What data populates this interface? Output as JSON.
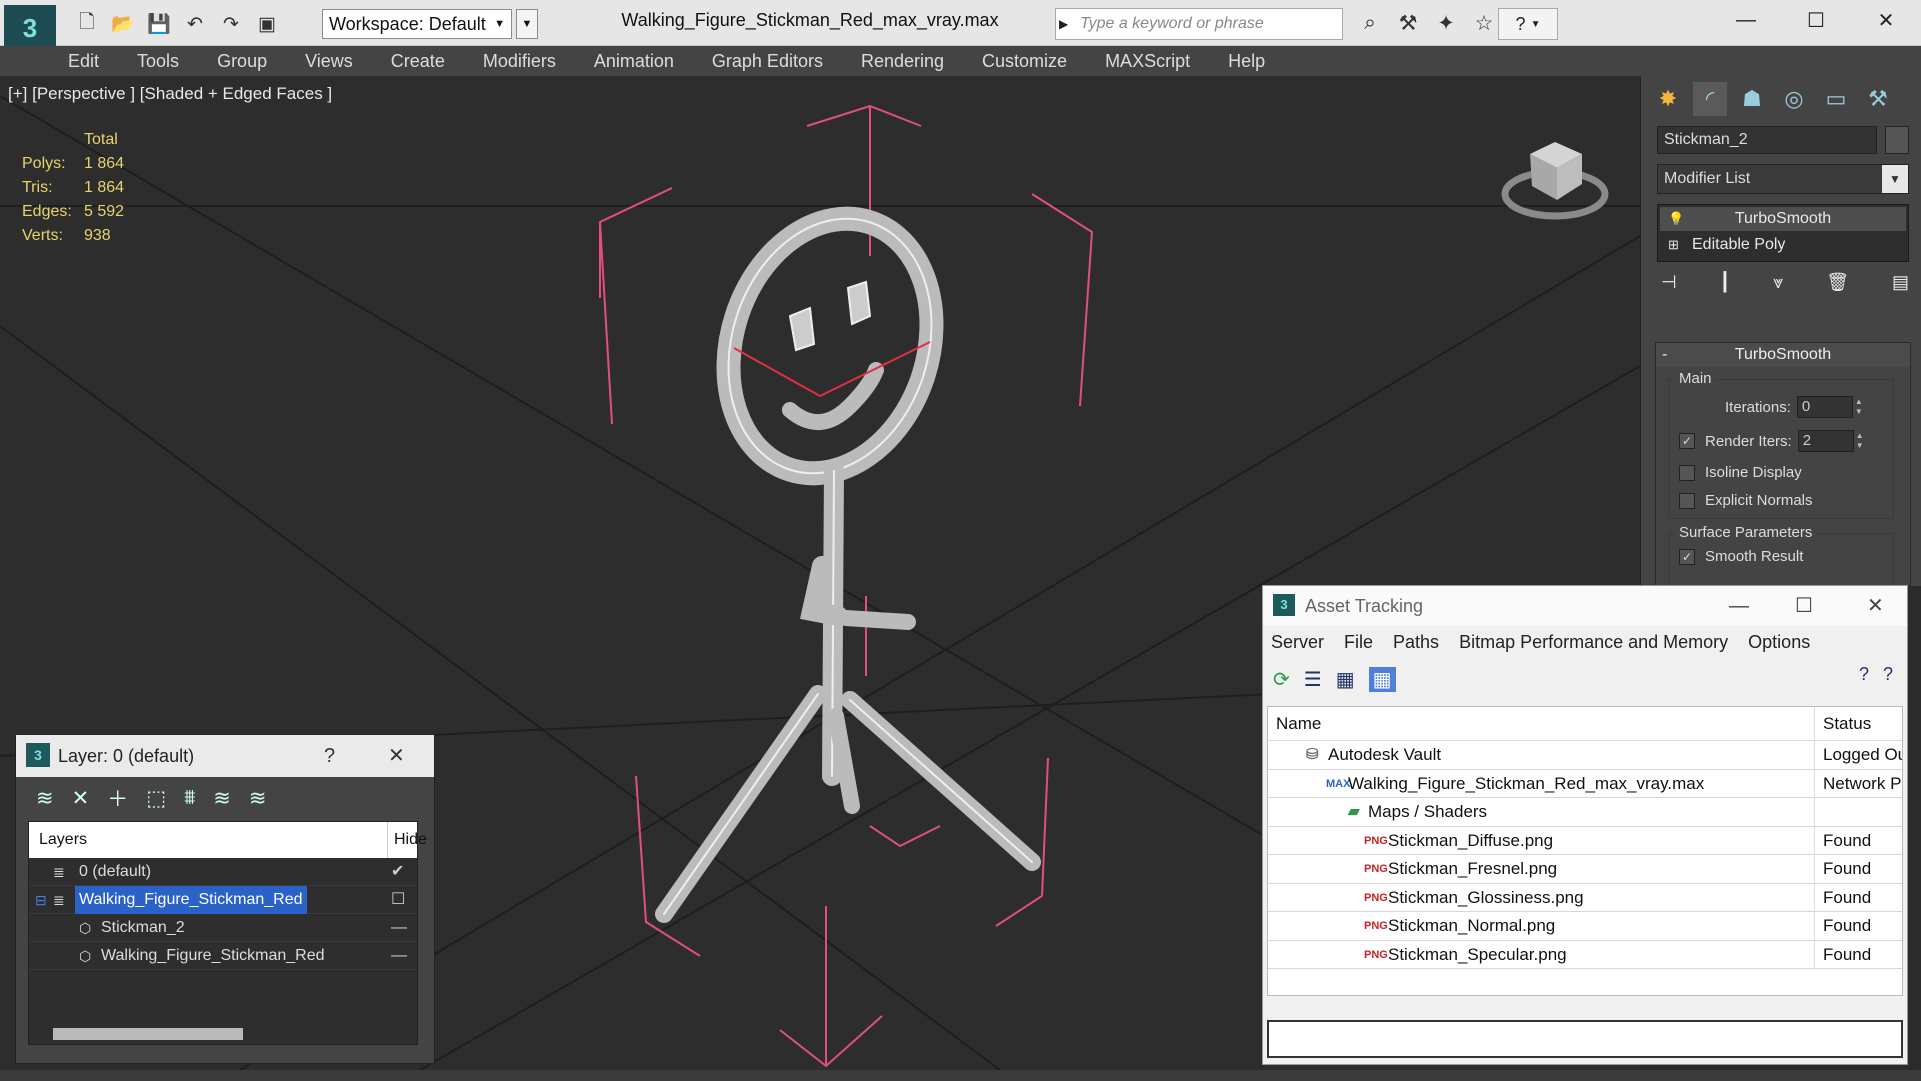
{
  "titlebar": {
    "workspace": "Workspace: Default",
    "document_title": "Walking_Figure_Stickman_Red_max_vray.max",
    "search_placeholder": "Type a keyword or phrase"
  },
  "menu": [
    "Edit",
    "Tools",
    "Group",
    "Views",
    "Create",
    "Modifiers",
    "Animation",
    "Graph Editors",
    "Rendering",
    "Customize",
    "MAXScript",
    "Help"
  ],
  "viewport": {
    "label": "[+] [Perspective ] [Shaded + Edged Faces ]",
    "stats_header": "Total",
    "stats": [
      {
        "key": "Polys:",
        "value": "1 864"
      },
      {
        "key": "Tris:",
        "value": "1 864"
      },
      {
        "key": "Edges:",
        "value": "5 592"
      },
      {
        "key": "Verts:",
        "value": "938"
      }
    ]
  },
  "command_panel": {
    "object_name": "Stickman_2",
    "modifier_list": "Modifier List",
    "stack": [
      "TurboSmooth",
      "Editable Poly"
    ],
    "rollout_title": "TurboSmooth",
    "main_group": "Main",
    "iterations_label": "Iterations:",
    "iterations_value": "0",
    "render_iters_label": "Render Iters:",
    "render_iters_value": "2",
    "isoline_label": "Isoline Display",
    "explicit_normals_label": "Explicit Normals",
    "surface_group": "Surface Parameters",
    "smooth_result_label": "Smooth Result"
  },
  "layer_panel": {
    "title": "Layer: 0 (default)",
    "help": "?",
    "col_layers": "Layers",
    "col_hide": "Hide",
    "rows": [
      {
        "name": "0 (default)"
      },
      {
        "name": "Walking_Figure_Stickman_Red"
      },
      {
        "name": "Stickman_2"
      },
      {
        "name": "Walking_Figure_Stickman_Red"
      }
    ]
  },
  "asset_tracking": {
    "title": "Asset Tracking",
    "menu": [
      "Server",
      "File",
      "Paths",
      "Bitmap Performance and Memory",
      "Options"
    ],
    "col_name": "Name",
    "col_status": "Status",
    "rows": [
      {
        "name": "Autodesk Vault",
        "status": "Logged Out",
        "icon": "vault-icon"
      },
      {
        "name": "Walking_Figure_Stickman_Red_max_vray.max",
        "status": "Network Path",
        "icon": "max-file-icon",
        "badge": "MAX"
      },
      {
        "name": "Maps / Shaders",
        "status": "",
        "icon": "maps-folder-icon"
      },
      {
        "name": "Stickman_Diffuse.png",
        "status": "Found",
        "icon": "png-file-icon",
        "badge": "PNG"
      },
      {
        "name": "Stickman_Fresnel.png",
        "status": "Found",
        "icon": "png-file-icon",
        "badge": "PNG"
      },
      {
        "name": "Stickman_Glossiness.png",
        "status": "Found",
        "icon": "png-file-icon",
        "badge": "PNG"
      },
      {
        "name": "Stickman_Normal.png",
        "status": "Found",
        "icon": "png-file-icon",
        "badge": "PNG"
      },
      {
        "name": "Stickman_Specular.png",
        "status": "Found",
        "icon": "png-file-icon",
        "badge": "PNG"
      }
    ]
  },
  "colors": {
    "accent": "#2a62c8",
    "bbox": "#e0507a",
    "stats": "#e8d36a"
  }
}
